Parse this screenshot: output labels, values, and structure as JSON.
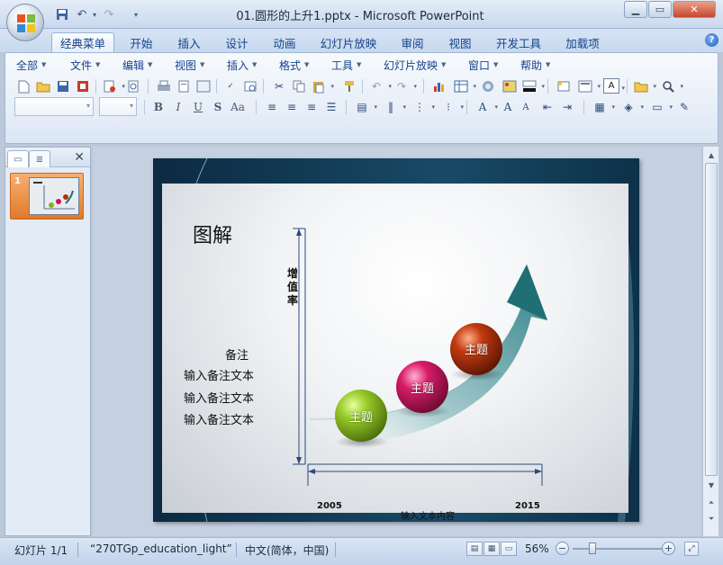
{
  "window": {
    "title": "01.圆形的上升1.pptx - Microsoft PowerPoint",
    "minimize_icon": "minimize-icon",
    "maximize_icon": "maximize-icon",
    "close_icon": "close-icon"
  },
  "quick_access": {
    "items": [
      "save-icon",
      "undo-icon",
      "redo-icon",
      "customize-dropdown-icon"
    ]
  },
  "tabs": [
    {
      "label": "经典菜单",
      "active": true
    },
    {
      "label": "开始"
    },
    {
      "label": "插入"
    },
    {
      "label": "设计"
    },
    {
      "label": "动画"
    },
    {
      "label": "幻灯片放映"
    },
    {
      "label": "审阅"
    },
    {
      "label": "视图"
    },
    {
      "label": "开发工具"
    },
    {
      "label": "加载项"
    }
  ],
  "classic_menu": [
    {
      "label": "全部"
    },
    {
      "label": "文件"
    },
    {
      "label": "编辑"
    },
    {
      "label": "视图"
    },
    {
      "label": "插入"
    },
    {
      "label": "格式"
    },
    {
      "label": "工具"
    },
    {
      "label": "幻灯片放映"
    },
    {
      "label": "窗口"
    },
    {
      "label": "帮助"
    }
  ],
  "format_buttons": {
    "bold": "B",
    "italic": "I",
    "underline": "U",
    "shadow": "S",
    "change_case": "Aa"
  },
  "slides_panel": {
    "thumbnail_number": "1"
  },
  "slide": {
    "title": "图解",
    "y_axis_label": "增值率",
    "notes_heading": "备注",
    "note_lines": [
      "输入备注文本",
      "输入备注文本",
      "输入备注文本"
    ],
    "year_start": "2005",
    "year_end": "2015",
    "x_axis_label": "输入文本内容",
    "balls": [
      {
        "label": "主题",
        "color": "#7fb21c"
      },
      {
        "label": "主题",
        "color": "#c8155a"
      },
      {
        "label": "主题",
        "color": "#b2300c"
      }
    ],
    "arrow_color": "#1f6f74"
  },
  "statusbar": {
    "slide_info": "幻灯片 1/1",
    "theme": "“270TGp_education_light”",
    "language": "中文(简体，中国)",
    "zoom": "56%",
    "zoom_level": 0.22
  }
}
